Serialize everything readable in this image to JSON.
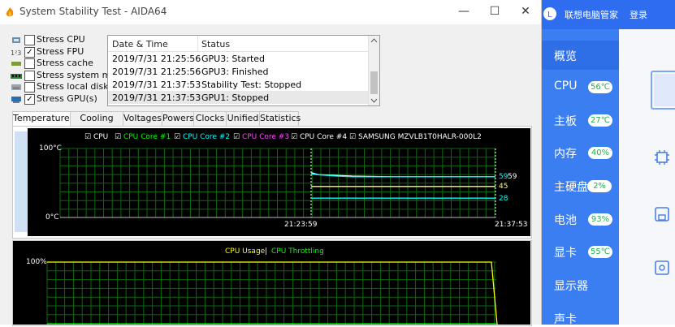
{
  "window": {
    "title": "System Stability Test - AIDA64",
    "minimize": "—",
    "maximize": "☐",
    "close": "✕"
  },
  "stress_options": [
    {
      "label": "Stress CPU",
      "checked": false
    },
    {
      "label": "Stress FPU",
      "checked": true
    },
    {
      "label": "Stress cache",
      "checked": false
    },
    {
      "label": "Stress system memo",
      "checked": false
    },
    {
      "label": "Stress local disks",
      "checked": false
    },
    {
      "label": "Stress GPU(s)",
      "checked": true
    }
  ],
  "log": {
    "headers": [
      "Date & Time",
      "Status"
    ],
    "rows": [
      [
        "2019/7/31 21:25:56",
        "GPU3: Started"
      ],
      [
        "2019/7/31 21:25:56",
        "GPU3: Finished"
      ],
      [
        "2019/7/31 21:37:53",
        "Stability Test: Stopped"
      ],
      [
        "2019/7/31 21:37:53",
        "GPU1: Stopped"
      ]
    ]
  },
  "tabs": [
    "Temperatures",
    "Cooling Fans",
    "Voltages",
    "Powers",
    "Clocks",
    "Unified",
    "Statistics"
  ],
  "temp_chart": {
    "legend": [
      {
        "label": "CPU",
        "color": "#ffffff"
      },
      {
        "label": "CPU Core #1",
        "color": "#00ff00"
      },
      {
        "label": "CPU Core #2",
        "color": "#00ffff"
      },
      {
        "label": "CPU Core #3",
        "color": "#ff44ff"
      },
      {
        "label": "CPU Core #4",
        "color": "#ffffff"
      },
      {
        "label": "SAMSUNG MZVLB1T0HALR-000L2",
        "color": "#ffffff"
      }
    ],
    "y_top": "100°C",
    "y_bottom": "0°C",
    "x_mid": "21:23:59",
    "x_end": "21:37:53",
    "right_labels": [
      {
        "text": "59",
        "color": "#00ffff"
      },
      {
        "text": "59",
        "color": "#ffffff"
      },
      {
        "text": "45",
        "color": "#ffff66"
      },
      {
        "text": "28",
        "color": "#00ffff"
      }
    ]
  },
  "usage_chart": {
    "legend_a": "CPU Usage",
    "legend_sep": "|",
    "legend_b": "CPU Throttling",
    "y_top": "100%"
  },
  "chart_data": [
    {
      "type": "line",
      "ylim": [
        0,
        100
      ],
      "x_ticks": [
        "21:23:59",
        "21:37:53"
      ],
      "series": [
        {
          "name": "CPU",
          "values": [
            65,
            62,
            61,
            60,
            59,
            59,
            59,
            59
          ]
        },
        {
          "name": "CPU Core #2",
          "values": [
            63,
            62,
            60,
            59,
            59,
            59,
            59,
            59
          ]
        },
        {
          "name": "SAMSUNG MZVLB1T0HALR-000L2",
          "values": [
            45,
            45,
            45,
            45,
            45,
            45,
            45,
            45
          ]
        },
        {
          "name": "CPU Core #4",
          "values": [
            28,
            28,
            28,
            28,
            28,
            28,
            28,
            28
          ]
        }
      ]
    },
    {
      "type": "line",
      "ylim": [
        0,
        100
      ],
      "series": [
        {
          "name": "CPU Usage",
          "values": [
            100,
            100,
            100,
            100,
            100,
            100,
            100,
            0
          ]
        },
        {
          "name": "CPU Throttling",
          "values": [
            0,
            0,
            0,
            0,
            0,
            0,
            0,
            0
          ]
        }
      ]
    }
  ],
  "lenovo": {
    "title": "联想电脑管家",
    "login": "登录",
    "items": [
      {
        "label": "概览",
        "badge": ""
      },
      {
        "label": "CPU",
        "badge": "56℃"
      },
      {
        "label": "主板",
        "badge": "27℃"
      },
      {
        "label": "内存",
        "badge": "40%"
      },
      {
        "label": "主硬盘",
        "badge": "2%"
      },
      {
        "label": "电池",
        "badge": "93%"
      },
      {
        "label": "显卡",
        "badge": "55℃"
      },
      {
        "label": "显示器",
        "badge": ""
      },
      {
        "label": "声卡",
        "badge": ""
      }
    ]
  }
}
